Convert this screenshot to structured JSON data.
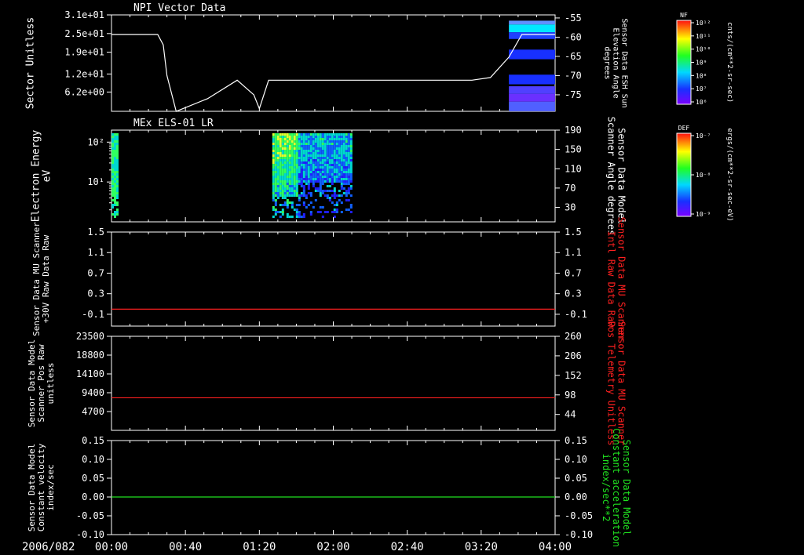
{
  "date_label": "2006/082",
  "time_ticks": [
    "00:00",
    "00:40",
    "01:20",
    "02:00",
    "02:40",
    "03:20",
    "04:00"
  ],
  "colors": {
    "axis": "#ffffff",
    "red": "#ff2020",
    "green": "#20e020"
  },
  "colorbars": [
    {
      "tag": "NF",
      "unit": "cnts/(cm**2-sr-sec)",
      "ticks": [
        "10¹²",
        "10¹¹",
        "10¹⁰",
        "10⁹",
        "10⁸",
        "10⁷",
        "10⁶"
      ]
    },
    {
      "tag": "DEF",
      "unit": "ergs/(cm**2-sr-sec-eV)",
      "ticks": [
        "10⁻⁷",
        "10⁻⁸",
        "10⁻⁹"
      ]
    }
  ],
  "chart_data": [
    {
      "type": "heatmap",
      "title": "NPI Vector Data",
      "ylabel": "Sector Unitless",
      "yticks": [
        "3.1e+01",
        "2.5e+01",
        "1.9e+01",
        "1.2e+01",
        "6.2e+00"
      ],
      "ylim": [
        0,
        31
      ],
      "right_ylabel": "Sensor Data ESH Sun Elevation Angle degrees",
      "right_yticks": [
        -55,
        -60,
        -65,
        -70,
        -75
      ],
      "right_ylim": [
        -79.3,
        -54.2
      ],
      "heatmap_time_range": [
        "03:35",
        "04:00"
      ],
      "series": [
        {
          "name": "Sensor Data ESH Sun Elevation Angle",
          "x": [
            "00:00",
            "00:25",
            "00:28",
            "00:30",
            "00:35",
            "00:52",
            "01:08",
            "01:17",
            "01:20",
            "01:25",
            "02:30",
            "03:00",
            "03:15",
            "03:25",
            "03:35",
            "03:42",
            "04:00"
          ],
          "y": [
            -59.3,
            -59.3,
            -62,
            -70,
            -79.3,
            -76,
            -71.2,
            -75,
            -78.6,
            -71.2,
            -71.2,
            -71.2,
            -71.2,
            -70.5,
            -65.2,
            -59.3,
            -59.3
          ]
        }
      ]
    },
    {
      "type": "heatmap",
      "title": "MEx ELS-01 LR",
      "ylabel": "Electron Energy eV",
      "yticks": [
        "10²",
        "10¹"
      ],
      "ylim": [
        1,
        200
      ],
      "right_ylabel": "Sensor Data Model Scanner Angle degrees",
      "right_yticks": [
        190,
        150,
        110,
        70,
        30
      ],
      "right_ylim": [
        0,
        190
      ],
      "data_blocks": [
        {
          "time_range": [
            "00:00",
            "00:03"
          ],
          "energy_range": [
            2,
            170
          ]
        },
        {
          "time_range": [
            "01:27",
            "02:10"
          ],
          "energy_range": [
            2,
            170
          ]
        }
      ]
    },
    {
      "type": "line",
      "ylabel": "Sensor Data MU Scanner +30V Raw Data Raw",
      "yticks": [
        1.5,
        1.1,
        0.7,
        0.3,
        -0.1
      ],
      "ylim": [
        -0.33,
        1.5
      ],
      "right_ylabel": "Sensor Data MU Scanner Intl Raw Data Raw",
      "right_yticks": [
        1.5,
        1.1,
        0.7,
        0.3,
        -0.1
      ],
      "series": [
        {
          "name": "Sensor Data MU Scanner Intl Raw Data",
          "x": [
            "00:00",
            "04:00"
          ],
          "y": [
            0,
            0
          ]
        }
      ]
    },
    {
      "type": "line",
      "ylabel": "Sensor Data Model Scanner Pos Raw unitless",
      "yticks": [
        23500,
        18800,
        14100,
        9400,
        4700
      ],
      "ylim": [
        0,
        23500
      ],
      "right_ylabel": "Sensor Data MU Scanner Pos Telemetry Unitless",
      "right_yticks": [
        260,
        206,
        152,
        98,
        44
      ],
      "right_ylim": [
        0,
        260
      ],
      "series": [
        {
          "name": "Sensor Data MU Scanner Pos Telemetry",
          "x": [
            "00:00",
            "04:00"
          ],
          "y": [
            90,
            90
          ]
        }
      ]
    },
    {
      "type": "line",
      "ylabel": "Sensor Data Model Constant velocity index/sec",
      "yticks": [
        0.15,
        0.1,
        0.05,
        0.0,
        -0.05,
        -0.1
      ],
      "ylim": [
        -0.1,
        0.15
      ],
      "right_ylabel": "Sensor Data Model Constant acceleration index/sec**2",
      "right_yticks": [
        0.15,
        0.1,
        0.05,
        0.0,
        -0.05,
        -0.1
      ],
      "series": [
        {
          "name": "Sensor Data Model Constant acceleration",
          "x": [
            "00:00",
            "04:00"
          ],
          "y": [
            0,
            0
          ]
        }
      ]
    }
  ]
}
